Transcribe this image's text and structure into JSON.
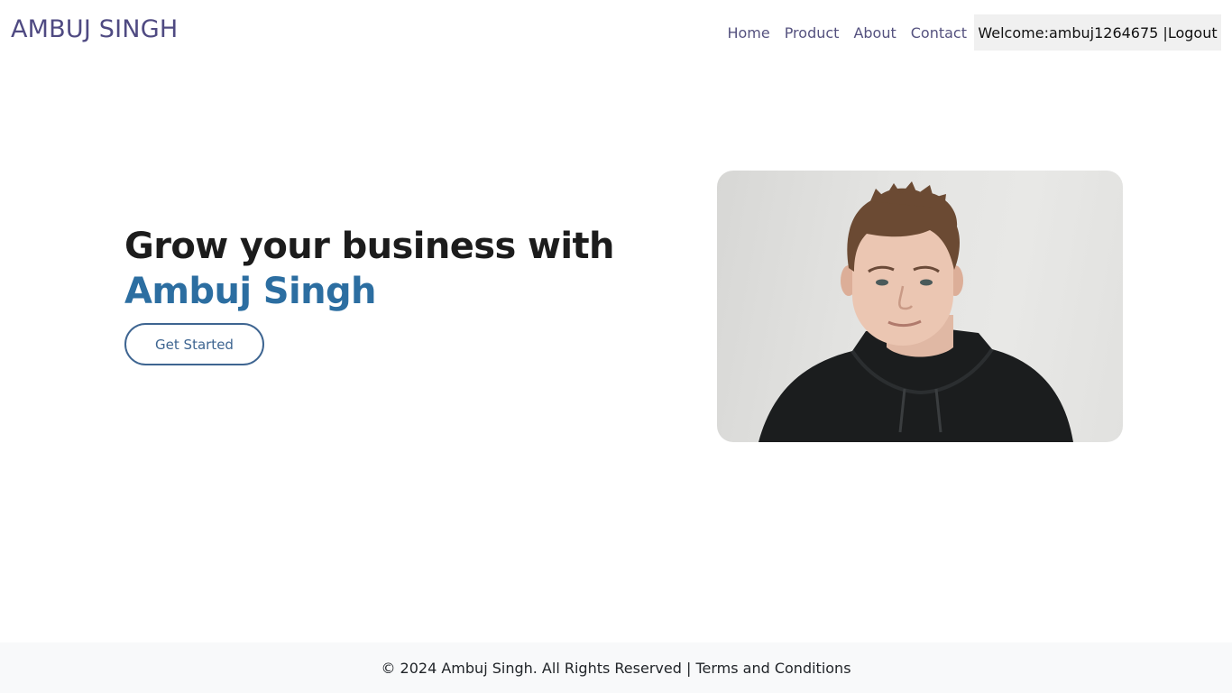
{
  "header": {
    "brand": "AMBUJ SINGH",
    "nav": [
      "Home",
      "Product",
      "About",
      "Contact"
    ],
    "welcome_text": "Welcome:ambuj1264675 |",
    "logout_label": "Logout"
  },
  "hero": {
    "title_line1": "Grow your business with",
    "title_accent": "Ambuj Singh",
    "cta_label": "Get Started"
  },
  "footer": {
    "copyright": "© 2024 Ambuj Singh. All Rights Reserved |",
    "terms_label": "Terms and Conditions"
  },
  "colors": {
    "brand": "#4f4a82",
    "accent": "#2c6ea1",
    "button_border": "#3e6591"
  }
}
